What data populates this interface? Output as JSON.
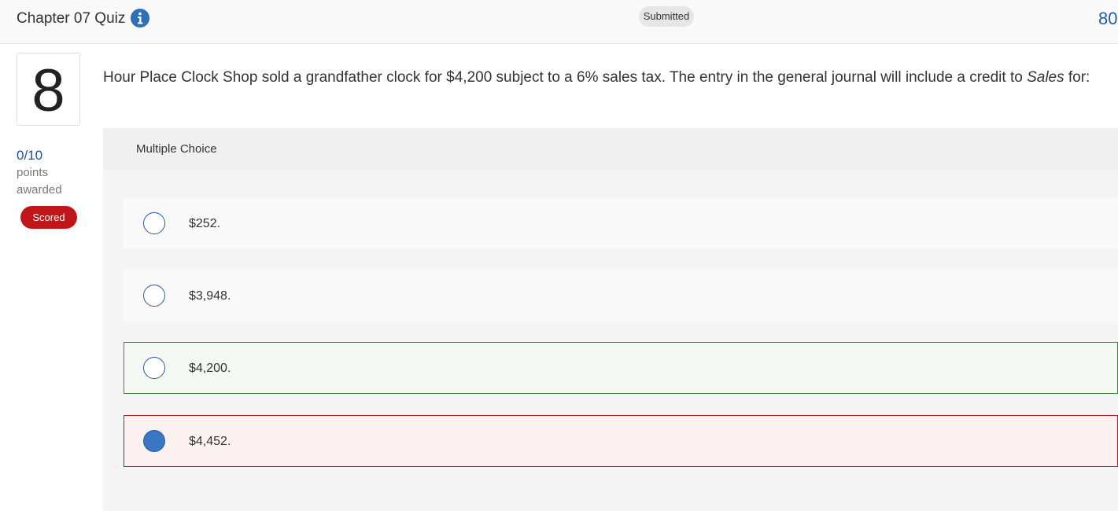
{
  "header": {
    "title": "Chapter 07 Quiz",
    "status": "Submitted",
    "score_peek": "80"
  },
  "question": {
    "number": "8",
    "text_before": "Hour Place Clock Shop sold a grandfather clock for $4,200 subject to a 6% sales tax. The entry in the general journal will include a credit to ",
    "text_emphasis": "Sales",
    "text_after": " for:"
  },
  "points": {
    "value": "0/10",
    "label_line1": "points",
    "label_line2": "awarded",
    "badge": "Scored"
  },
  "multiple_choice": {
    "label": "Multiple Choice",
    "options": [
      {
        "label": "$252.",
        "selected": false,
        "state": "neutral"
      },
      {
        "label": "$3,948.",
        "selected": false,
        "state": "neutral"
      },
      {
        "label": "$4,200.",
        "selected": false,
        "state": "correct"
      },
      {
        "label": "$4,452.",
        "selected": true,
        "state": "incorrect"
      }
    ]
  },
  "colors": {
    "accent": "#2f6fb5",
    "scored_badge": "#c0161a",
    "correct_border": "#3b8a3b",
    "incorrect_border": "#c0161a"
  },
  "icons": {
    "info": "info-icon"
  }
}
